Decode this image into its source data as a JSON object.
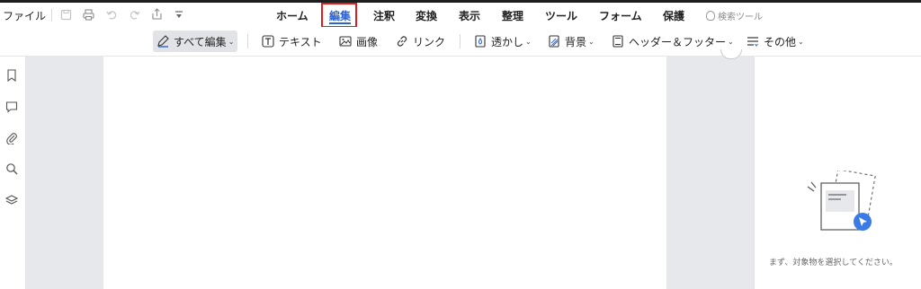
{
  "menubar": {
    "file_label": "ファイル",
    "quick_access": [
      "save-icon",
      "print-icon",
      "undo-icon",
      "redo-icon",
      "share-icon",
      "dropdown-icon"
    ],
    "tabs": [
      {
        "label": "ホーム"
      },
      {
        "label": "編集",
        "active": true
      },
      {
        "label": "注釈"
      },
      {
        "label": "変換"
      },
      {
        "label": "表示"
      },
      {
        "label": "整理"
      },
      {
        "label": "ツール"
      },
      {
        "label": "フォーム"
      },
      {
        "label": "保護"
      }
    ],
    "search_tools_label": "検索ツール"
  },
  "toolbar": {
    "items": [
      {
        "label": "すべて編集",
        "icon": "pencil-icon",
        "dropdown": true,
        "selected": true
      },
      {
        "label": "テキスト",
        "icon": "text-box-icon"
      },
      {
        "label": "画像",
        "icon": "image-icon"
      },
      {
        "label": "リンク",
        "icon": "link-icon"
      },
      {
        "label": "透かし",
        "icon": "watermark-icon",
        "dropdown": true
      },
      {
        "label": "背景",
        "icon": "background-icon",
        "dropdown": true
      },
      {
        "label": "ヘッダー＆フッター",
        "icon": "header-footer-icon",
        "dropdown": true
      },
      {
        "label": "その他",
        "icon": "more-lines-icon",
        "dropdown": true
      }
    ],
    "caret": "⌄"
  },
  "left_rail": [
    "bookmark-icon",
    "comment-icon",
    "attachment-icon",
    "search-icon",
    "layers-icon"
  ],
  "right_panel": {
    "message": "まず、対象物を選択してください。"
  },
  "colors": {
    "accent": "#2a63d6",
    "highlight": "#e21b1b"
  }
}
